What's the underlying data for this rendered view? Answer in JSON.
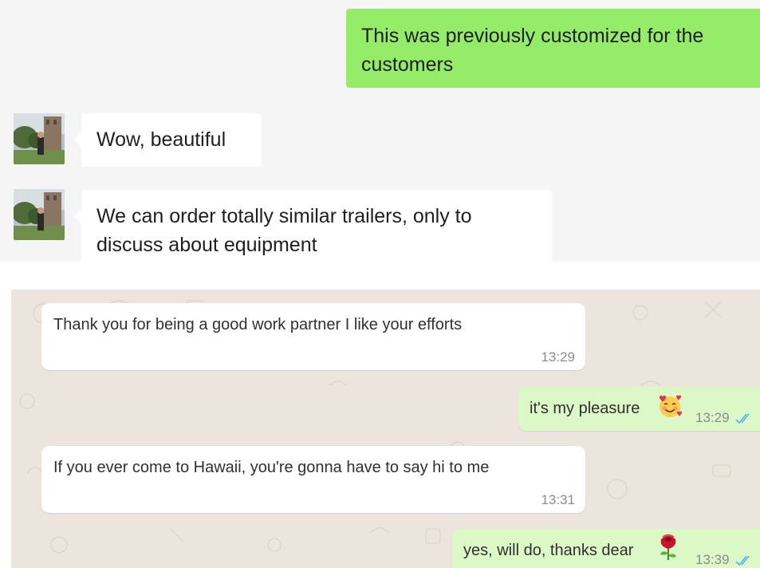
{
  "top_chat": {
    "messages": [
      {
        "direction": "outgoing",
        "text_line1": "This was previously customized for the",
        "text_line2": "customers"
      },
      {
        "direction": "incoming",
        "text": "Wow, beautiful"
      },
      {
        "direction": "incoming",
        "text_line1": "We can order totally similar trailers, only to",
        "text_line2": "discuss about equipment"
      }
    ]
  },
  "bottom_chat": {
    "messages": [
      {
        "direction": "incoming",
        "text": "Thank you for being a good work partner I like your efforts",
        "time": "13:29"
      },
      {
        "direction": "outgoing",
        "text": "it's my pleasure",
        "emoji": "smiling-face-with-hearts",
        "time": "13:29",
        "status": "read"
      },
      {
        "direction": "incoming",
        "text": "If you ever come to Hawaii, you're gonna have to say hi to me",
        "time": "13:31"
      },
      {
        "direction": "outgoing",
        "text": "yes, will do, thanks dear",
        "emoji": "rose",
        "time": "13:39",
        "status": "read"
      }
    ]
  },
  "colors": {
    "wechat_outgoing": "#95ec69",
    "wechat_background": "#f5f5f5",
    "whatsapp_outgoing": "#dcf8c6",
    "whatsapp_background": "#ece5dd",
    "read_ticks": "#4fb6ec"
  }
}
